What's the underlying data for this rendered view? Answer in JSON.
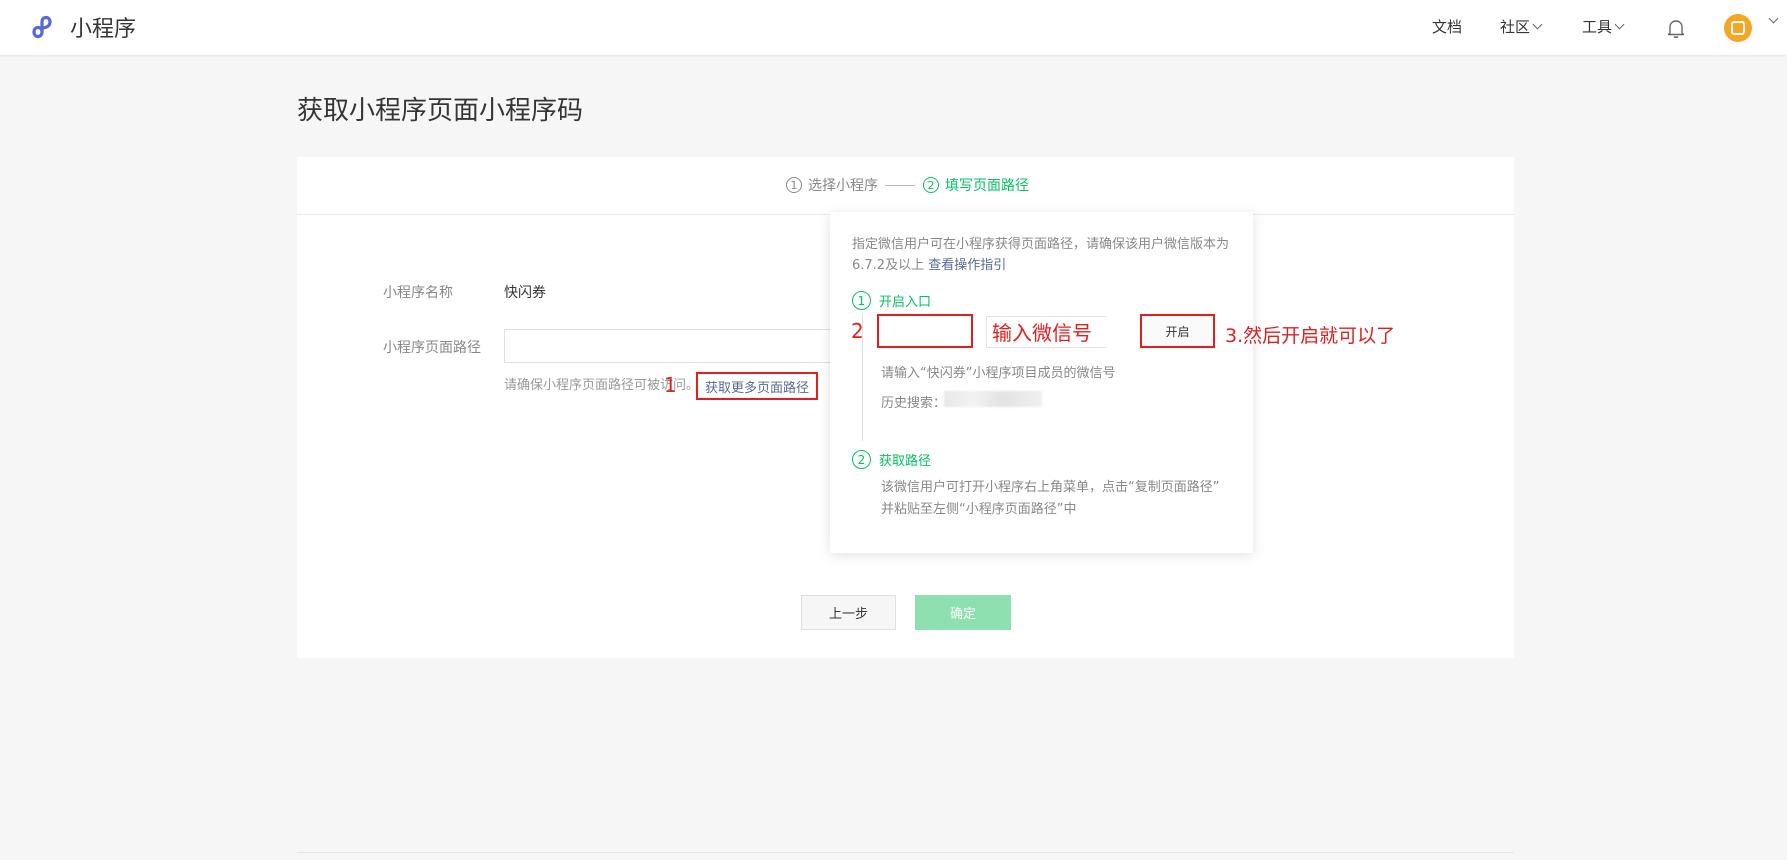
{
  "header": {
    "app_name": "小程序",
    "nav": {
      "docs": "文档",
      "community": "社区",
      "tools": "工具"
    },
    "icons": {
      "logo": "miniprogram-logo-icon",
      "bell": "bell-icon",
      "avatar": "user-avatar"
    },
    "colors": {
      "logo": "#5b67d8",
      "avatar": "#f5a623"
    }
  },
  "page": {
    "title": "获取小程序页面小程序码"
  },
  "steps": [
    {
      "num": "1",
      "label": "选择小程序",
      "state": "done"
    },
    {
      "num": "2",
      "label": "填写页面路径",
      "state": "active"
    }
  ],
  "form": {
    "name_label": "小程序名称",
    "name_value": "快闪券",
    "path_label": "小程序页面路径",
    "path_value": "",
    "hint": "请确保小程序页面路径可被访问。",
    "more_link": "获取更多页面路径"
  },
  "annotations": {
    "one": "1",
    "two": "2",
    "input_hint": "输入微信号",
    "three": "3.然后开启就可以了"
  },
  "popover": {
    "desc": "指定微信用户可在小程序获得页面路径，请确保该用户微信版本为6.7.2及以上",
    "guide_link": "查看操作指引",
    "step1_num": "1",
    "step1_title": "开启入口",
    "wechat_input_value": "",
    "open_button": "开启",
    "input_tip": "请输入“快闪券”小程序项目成员的微信号",
    "history_label": "历史搜索：",
    "step2_num": "2",
    "step2_title": "获取路径",
    "step2_desc_1": "该微信用户可打开小程序右上角菜单，点击“复制页面路径”",
    "step2_desc_2": "并粘贴至左侧“小程序页面路径”中"
  },
  "buttons": {
    "prev": "上一步",
    "confirm": "确定"
  },
  "theme": {
    "accent": "#07c160",
    "confirm_disabled": "#8fe0b1",
    "link": "#576b95",
    "annotation": "#e02020"
  }
}
